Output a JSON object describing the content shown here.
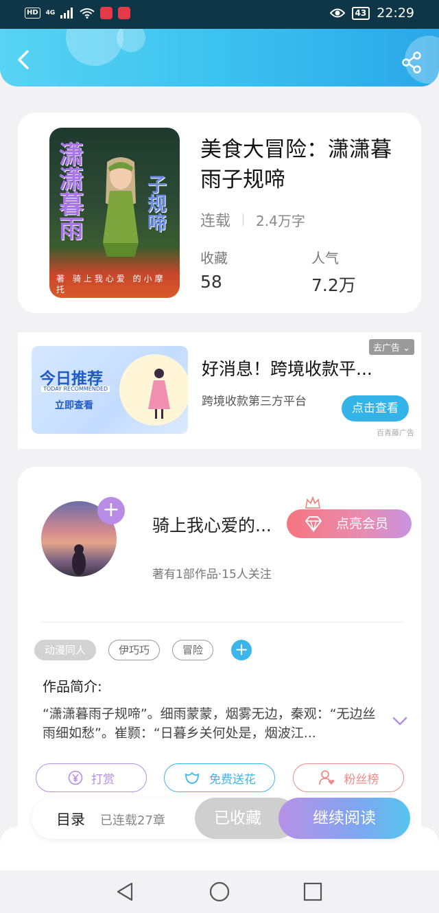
{
  "status_bar": {
    "network": "HD",
    "signal": "4G",
    "battery": "43",
    "time": "22:29"
  },
  "header": {
    "back_icon": "chevron-left-icon",
    "share_icon": "share-icon",
    "gradient": [
      "#58d3f3",
      "#2aa7e8"
    ]
  },
  "book": {
    "cover_text_main": "潇潇暮雨",
    "cover_text_side": "子规啼",
    "cover_text_bottom": "著 骑上我心爱 的小摩托",
    "title": "美食大冒险：潇潇暮雨子规啼",
    "status": "连载",
    "word_count": "2.4万字",
    "stats": [
      {
        "label": "收藏",
        "value": "58"
      },
      {
        "label": "人气",
        "value": "7.2万"
      }
    ]
  },
  "ad": {
    "image_title": "今日推荐",
    "image_subtitle": "TODAY RECOMMENDED",
    "image_cta": "立即查看",
    "close_label": "去广告",
    "title": "好消息！跨境收款平...",
    "description": "跨境收款第三方平台",
    "button_label": "点击查看",
    "source": "百青藤广告"
  },
  "author": {
    "name": "骑上我心爱的...",
    "stats": "著有1部作品·15人关注",
    "vip_label": "点亮会员",
    "tags": [
      "动漫同人",
      "伊巧巧",
      "冒险"
    ],
    "intro_label": "作品简介:",
    "intro_text": "“潇潇暮雨子规啼”。细雨蒙蒙，烟雾无边，秦观：“无边丝雨细如愁”。崔颢：“日暮乡关何处是，烟波江..."
  },
  "actions": [
    {
      "label": "打赏",
      "icon": "yen-icon"
    },
    {
      "label": "免费送花",
      "icon": "flower-icon"
    },
    {
      "label": "粉丝榜",
      "icon": "fan-user-icon"
    }
  ],
  "bottom_bar": {
    "toc_label": "目录",
    "toc_count": "已连载27章",
    "collected_label": "已收藏",
    "read_label": "继续阅读"
  },
  "colors": {
    "accent_blue": "#3cb6ea",
    "accent_purple": "#b48de2",
    "accent_pink": "#ef8a86"
  }
}
